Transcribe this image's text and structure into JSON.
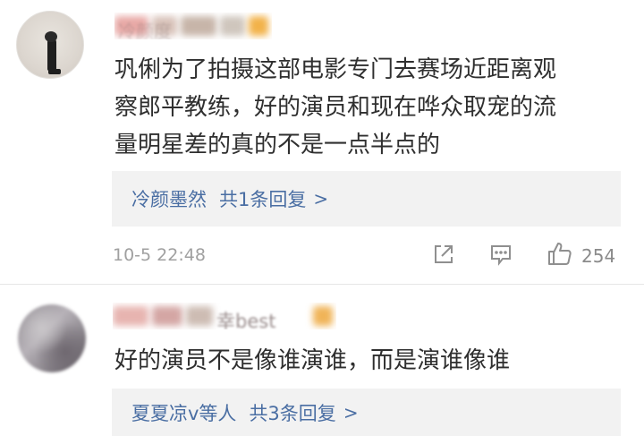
{
  "comments": [
    {
      "username": "冷颜度",
      "text": "巩俐为了拍摄这部电影专门去赛场近距离观\n察郎平教练，好的演员和现在哗众取宠的流\n量明星差的真的不是一点半点的",
      "reply_name": "冷颜墨然",
      "reply_count": "共1条回复",
      "reply_chevron": ">",
      "time": "10-5 22:48",
      "like_count": "254"
    },
    {
      "username": "幸best",
      "text": "好的演员不是像谁演谁，而是演谁像谁",
      "reply_name": "夏夏凉v等人",
      "reply_count": "共3条回复",
      "reply_chevron": ">"
    }
  ],
  "colors": {
    "link": "#4a6ea3",
    "reply_bg": "#f2f2f2",
    "meta_text": "#a0a0a0",
    "body_text": "#2f2f2f"
  },
  "icons": [
    "share-icon",
    "comment-icon",
    "like-icon"
  ]
}
